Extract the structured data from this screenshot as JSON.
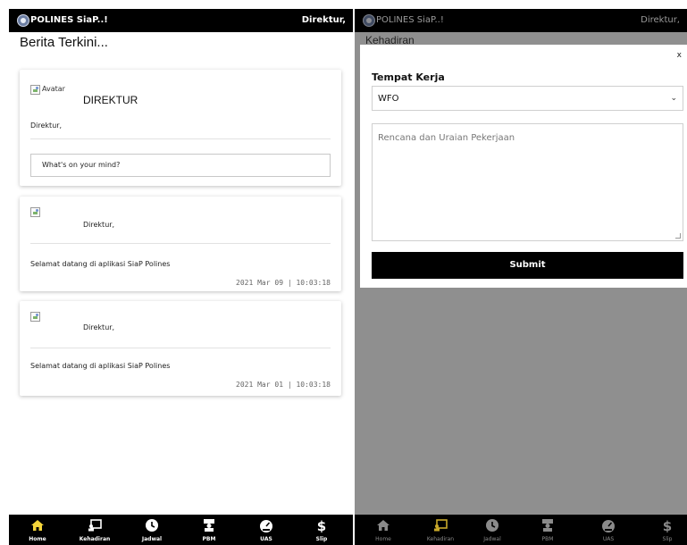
{
  "left": {
    "app_title": "POLINES SiaP..!",
    "user": "Direktur,",
    "heading": "Berita Terkini...",
    "profile_card": {
      "avatar_alt": "Avatar",
      "name": "DIREKTUR",
      "role": "Direktur,",
      "input_placeholder": "What's on your mind?"
    },
    "posts": [
      {
        "author": "Direktur,",
        "message": "Selamat datang di aplikasi SiaP Polines",
        "timestamp": "2021 Mar 09 | 10:03:18"
      },
      {
        "author": "Direktur,",
        "message": "Selamat datang di aplikasi SiaP Polines",
        "timestamp": "2021 Mar 01 | 10:03:18"
      }
    ],
    "nav": [
      {
        "label": "Home",
        "icon": "home-icon",
        "active": true
      },
      {
        "label": "Kehadiran",
        "icon": "kehadiran-icon",
        "active": false
      },
      {
        "label": "Jadwal",
        "icon": "clock-icon",
        "active": false
      },
      {
        "label": "PBM",
        "icon": "pbm-icon",
        "active": false
      },
      {
        "label": "UAS",
        "icon": "gauge-icon",
        "active": false
      },
      {
        "label": "Slip",
        "icon": "dollar-icon",
        "active": false
      }
    ]
  },
  "right": {
    "app_title": "POLINES SiaP..!",
    "user": "Direktur,",
    "page_title": "Kehadiran",
    "modal": {
      "close_label": "x",
      "field_label": "Tempat Kerja",
      "select_value": "WFO",
      "textarea_placeholder": "Rencana dan Uraian Pekerjaan",
      "submit_label": "Submit"
    },
    "nav": [
      {
        "label": "Home",
        "icon": "home-icon",
        "active": false
      },
      {
        "label": "Kehadiran",
        "icon": "kehadiran-icon",
        "active": true
      },
      {
        "label": "Jadwal",
        "icon": "clock-icon",
        "active": false
      },
      {
        "label": "PBM",
        "icon": "pbm-icon",
        "active": false
      },
      {
        "label": "UAS",
        "icon": "gauge-icon",
        "active": false
      },
      {
        "label": "Slip",
        "icon": "dollar-icon",
        "active": false
      }
    ]
  },
  "colors": {
    "active_nav": "#f5d53a",
    "inactive_nav_left": "#ffffff",
    "inactive_nav_right": "#8a8a8a",
    "overlay": "#8f8f8f"
  }
}
